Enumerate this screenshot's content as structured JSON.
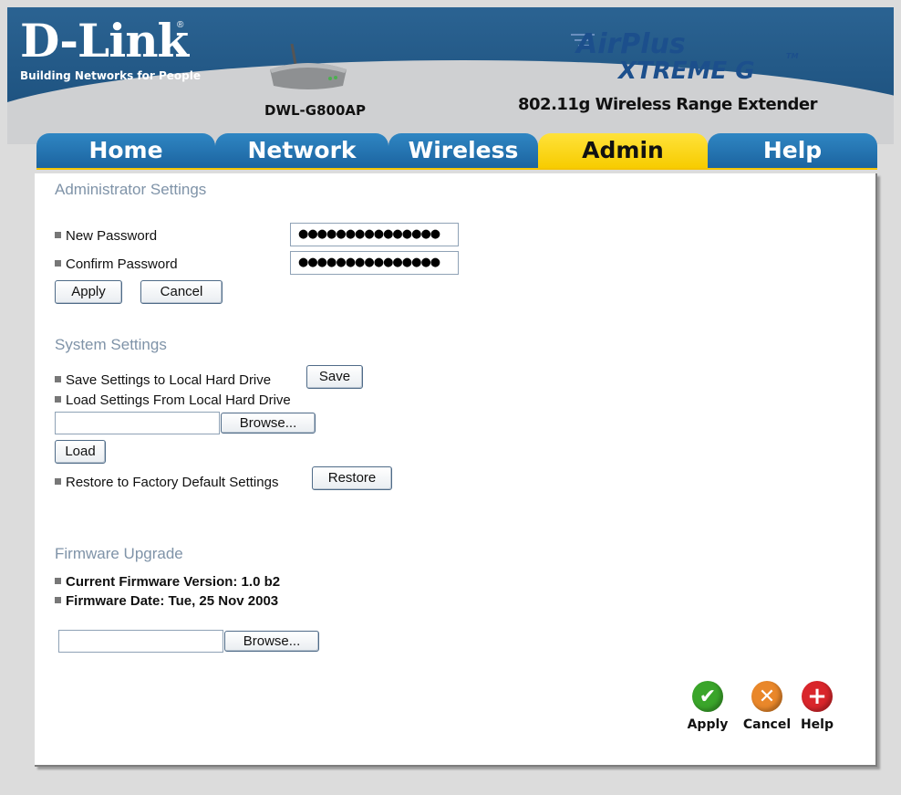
{
  "header": {
    "logo": "D-Link",
    "tagline": "Building Networks for People",
    "model": "DWL-G800AP",
    "brand_line1": "AirPlus",
    "brand_line2": "XTREME G",
    "brand_tm": "TM",
    "subtitle": "802.11g Wireless Range Extender"
  },
  "tabs": [
    {
      "label": "Home",
      "active": false
    },
    {
      "label": "Network",
      "active": false
    },
    {
      "label": "Wireless",
      "active": false
    },
    {
      "label": "Admin",
      "active": true
    },
    {
      "label": "Help",
      "active": false
    }
  ],
  "admin_settings": {
    "title": "Administrator Settings",
    "new_password_label": "New Password",
    "new_password_value": "●●●●●●●●●●●●●●●",
    "confirm_password_label": "Confirm Password",
    "confirm_password_value": "●●●●●●●●●●●●●●●",
    "apply_label": "Apply",
    "cancel_label": "Cancel"
  },
  "system_settings": {
    "title": "System Settings",
    "save_label": "Save Settings to Local Hard Drive",
    "save_button": "Save",
    "load_label": "Load Settings From Local Hard Drive",
    "load_file_value": "",
    "browse_button": "Browse...",
    "load_button": "Load",
    "restore_label": "Restore to Factory Default Settings",
    "restore_button": "Restore"
  },
  "firmware": {
    "title": "Firmware Upgrade",
    "version_text": "Current Firmware Version: 1.0 b2",
    "date_text": "Firmware Date: Tue, 25 Nov 2003",
    "file_value": "",
    "browse_button": "Browse..."
  },
  "actions": {
    "apply": "Apply",
    "cancel": "Cancel",
    "help": "Help"
  },
  "colors": {
    "tab_blue": "#1c64a0",
    "tab_active": "#f7cc00",
    "section_title": "#7f93a8",
    "apply_green": "#3aa52a",
    "cancel_orange": "#e9872a",
    "help_red": "#d9262b"
  }
}
